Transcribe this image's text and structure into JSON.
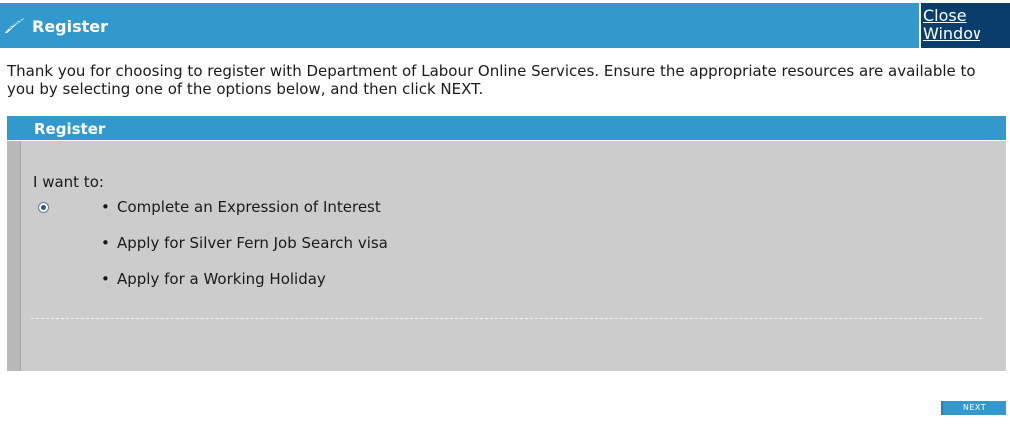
{
  "header": {
    "title": "Register",
    "close_label": "Close Window",
    "logo_icon": "silver-fern-icon"
  },
  "intro": {
    "text": "Thank you for choosing to register with Department of Labour Online Services. Ensure the appropriate resources are available to you by selecting one of the options below, and then click NEXT."
  },
  "panel": {
    "title": "Register",
    "prompt": "I want to:",
    "selected_index": 0,
    "options": [
      "Complete an Expression of Interest",
      "Apply for Silver Fern Job Search visa",
      "Apply for a Working Holiday"
    ]
  },
  "actions": {
    "next_label": "NEXT"
  },
  "colors": {
    "accent": "#3399cc",
    "close_bg": "#0a3d6b",
    "panel_bg": "#cccccc"
  }
}
